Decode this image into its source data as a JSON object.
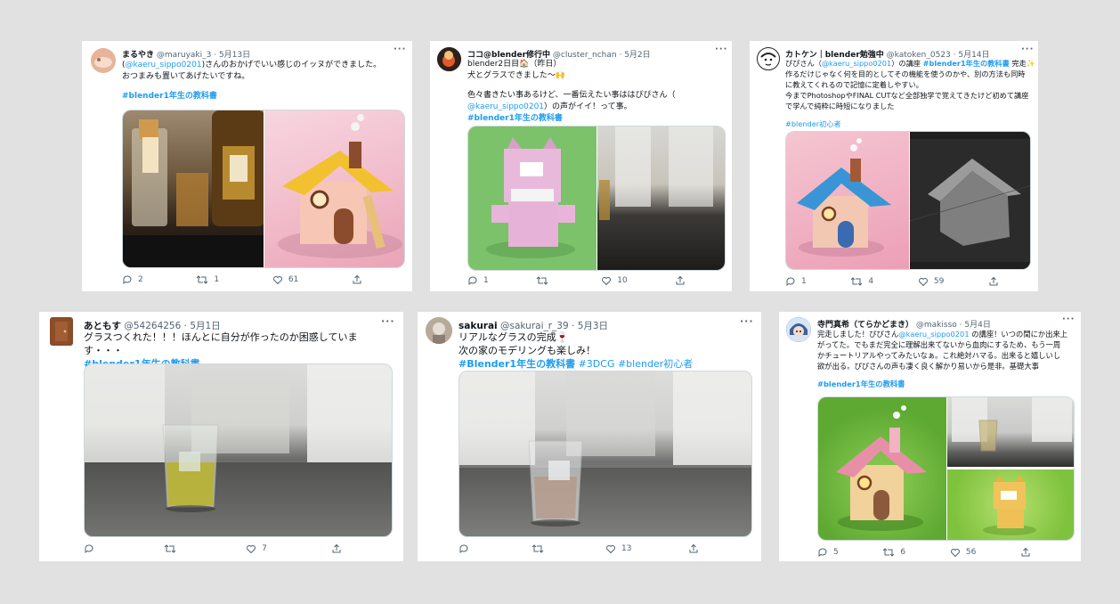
{
  "tweets": [
    {
      "name": "まるやき",
      "handle": "@maruyaki_3",
      "sep": " · ",
      "date": "5月13日",
      "line1_a": "(",
      "line1_link": "@kaeru_sippo0201",
      "line1_b": ")さんのおかげでいい感じのイッヌができました。",
      "line2": "おつまみも置いてあげたいですね。",
      "tag": "#blender1年生の教科書",
      "replies": "2",
      "retweets": "1",
      "likes": "61"
    },
    {
      "name": "ココ@blender修行中",
      "handle": "@cluster_nchan",
      "sep": " · ",
      "date": "5月2日",
      "line1": "blender2日目🏠（昨日）",
      "line2": "犬とグラスできました〜🙌",
      "line3": "色々書きたい事あるけど、一番伝えたい事ははぴぴさん（",
      "line4_link": "@kaeru_sippo0201",
      "line4_b": "）の声がイイ！って事。",
      "tag": "#blender1年生の教科書",
      "replies": "1",
      "retweets": "",
      "likes": "10"
    },
    {
      "name": "カトケン｜blender勉強中",
      "handle": "@katoken_0523",
      "sep": " · ",
      "date": "5月14日",
      "line1_a": "ぴぴさん（",
      "line1_link": "@kaeru_sippo0201",
      "line1_b": "）の講座 ",
      "line1_tag": "#blender1年生の教科書",
      "line1_c": " 完走✨",
      "line2": "作るだけじゃなく何を目的としてその機能を使うのかや、別の方法も同時",
      "line3": "に教えてくれるので記憶に定着しやすい。",
      "line4": "今までPhotoshopやFINAL CUTなど全部独学で覚えてきたけど初めて講座",
      "line5": "で学んで純粋に時短になりました",
      "tag": "#blender初心者",
      "replies": "1",
      "retweets": "4",
      "likes": "59"
    },
    {
      "name": "あともす",
      "handle": "@54264256",
      "sep": " · ",
      "date": "5月1日",
      "line1": "グラスつくれた！！！ほんとに自分が作ったのか困惑しています・・・",
      "tag": "#blender1年生の教科書",
      "replies": "",
      "retweets": "",
      "likes": "7"
    },
    {
      "name": "sakurai",
      "handle": "@sakurai_r_39",
      "sep": " · ",
      "date": "5月3日",
      "line1": "リアルなグラスの完成🍷",
      "line2": "次の家のモデリングも楽しみ！",
      "tag1": "#Blender1年生の教科書",
      "tag2": "#3DCG",
      "tag3": "#blender初心者",
      "replies": "",
      "retweets": "",
      "likes": "13"
    },
    {
      "name": "寺門真希（てらかどまき）",
      "handle": "@makisso",
      "sep": " · ",
      "date": "5月4日",
      "line1_a": "完走しました！ぴぴさん",
      "line1_link": "@kaeru_sippo0201",
      "line1_b": " の講座！いつの間にか出来上",
      "line2": "がってた。でもまだ完全に理解出来てないから血肉にするため、もう一周",
      "line3": "かチュートリアルやってみたいなぁ。これ絶対ハマる。出来ると嬉しいし",
      "line4": "欲が出る。ぴぴさんの声も凄く良く解かり易いから是非。基礎大事",
      "tag": "#blender1年生の教科書",
      "replies": "5",
      "retweets": "6",
      "likes": "56"
    }
  ],
  "ui": {
    "more": "···"
  },
  "colors": {
    "link": "#1d9bf0",
    "muted": "#536471",
    "background": "#e1e1e1"
  },
  "icons": [
    "reply-icon",
    "retweet-icon",
    "like-icon",
    "share-icon",
    "more-icon"
  ]
}
